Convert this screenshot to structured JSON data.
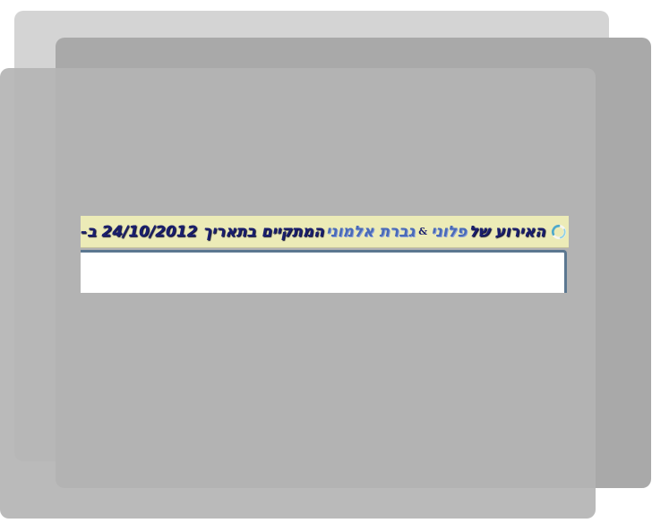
{
  "banner": {
    "prefix": "האירוע של",
    "name1": "פלוני",
    "ampersand": "&",
    "name2": "גברת אלמוני",
    "suffix": "המתקיים בתאריך 24/10/2012 ב-",
    "icon": "spinner-icon",
    "background_color": "#ecebb7",
    "text_color": "#1a1f6e",
    "name_color": "#4a6ab8"
  },
  "input": {
    "value": ""
  }
}
